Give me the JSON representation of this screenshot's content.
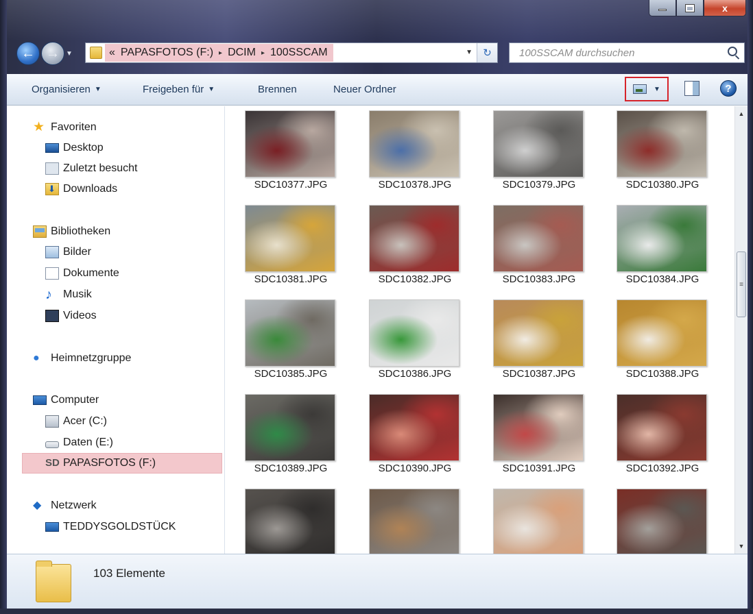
{
  "window": {
    "caption": {
      "minimize": "–",
      "maximize": "□",
      "close": "x"
    }
  },
  "nav": {
    "back": "←",
    "forward": "→",
    "dropdown": "▼"
  },
  "address": {
    "chevron": "«",
    "segments": [
      "PAPASFOTOS (F:)",
      "DCIM",
      "100SSCAM"
    ],
    "separator": "▸",
    "dropdown": "▼",
    "refresh": "↻"
  },
  "search": {
    "placeholder": "100SSCAM durchsuchen"
  },
  "toolbar": {
    "organize": "Organisieren",
    "share": "Freigeben für",
    "burn": "Brennen",
    "new_folder": "Neuer Ordner",
    "arrow": "▼",
    "help": "?"
  },
  "sidebar": {
    "favorites": "Favoriten",
    "desktop": "Desktop",
    "recent": "Zuletzt besucht",
    "downloads": "Downloads",
    "libraries": "Bibliotheken",
    "pictures": "Bilder",
    "documents": "Dokumente",
    "music": "Musik",
    "videos": "Videos",
    "homegroup": "Heimnetzgruppe",
    "computer": "Computer",
    "drive_c": "Acer (C:)",
    "drive_e": "Daten (E:)",
    "drive_f": "PAPASFOTOS (F:)",
    "network": "Netzwerk",
    "network_pc": "TEDDYSGOLDSTÜCK",
    "sd_glyph": "SD"
  },
  "files": [
    {
      "name": "SDC10377.JPG"
    },
    {
      "name": "SDC10378.JPG"
    },
    {
      "name": "SDC10379.JPG"
    },
    {
      "name": "SDC10380.JPG"
    },
    {
      "name": "SDC10381.JPG"
    },
    {
      "name": "SDC10382.JPG"
    },
    {
      "name": "SDC10383.JPG"
    },
    {
      "name": "SDC10384.JPG"
    },
    {
      "name": "SDC10385.JPG"
    },
    {
      "name": "SDC10386.JPG"
    },
    {
      "name": "SDC10387.JPG"
    },
    {
      "name": "SDC10388.JPG"
    },
    {
      "name": "SDC10389.JPG"
    },
    {
      "name": "SDC10390.JPG"
    },
    {
      "name": "SDC10391.JPG"
    },
    {
      "name": "SDC10392.JPG"
    },
    {
      "name": ""
    },
    {
      "name": ""
    },
    {
      "name": ""
    },
    {
      "name": ""
    }
  ],
  "thumb_colors": [
    [
      "#3a3436",
      "#7a1f24",
      "#b8a8a0"
    ],
    [
      "#8a7d6b",
      "#4c6fa8",
      "#c9c0b0"
    ],
    [
      "#9a9896",
      "#cfcfcf",
      "#5b5a58"
    ],
    [
      "#5a5048",
      "#8e2d2a",
      "#bfb8ac"
    ],
    [
      "#7e8a92",
      "#e8e0cc",
      "#d6a53a"
    ],
    [
      "#6b5a52",
      "#c8c2bc",
      "#9e2c2c"
    ],
    [
      "#7d6e63",
      "#c9c6c2",
      "#a55b52"
    ],
    [
      "#a9aeb3",
      "#e9eaea",
      "#3a7a3a"
    ],
    [
      "#b6bbbf",
      "#3a8a3a",
      "#6f6a62"
    ],
    [
      "#cfd3d4",
      "#38983a",
      "#e9e9e9"
    ],
    [
      "#b88a5a",
      "#f1ece3",
      "#c9a23a"
    ],
    [
      "#b8872f",
      "#f0ebe2",
      "#d4a84a"
    ],
    [
      "#6b6a64",
      "#2f8a48",
      "#3c3a38"
    ],
    [
      "#4a2c28",
      "#d98a78",
      "#b23232"
    ],
    [
      "#3c302c",
      "#c24848",
      "#e0ccbe"
    ],
    [
      "#4b2f2a",
      "#e2b6a6",
      "#8a3a30"
    ],
    [
      "#56524e",
      "#9c9894",
      "#2f2d2c"
    ],
    [
      "#6d5a4a",
      "#b08356",
      "#8c8782"
    ],
    [
      "#c0b7ac",
      "#e9e4de",
      "#d9a07a"
    ],
    [
      "#7a2e26",
      "#a3a09b",
      "#5b5752"
    ]
  ],
  "status": {
    "count": "103 Elemente"
  },
  "scrollbar": {
    "up": "▲",
    "down": "▼",
    "grip": "≡"
  }
}
